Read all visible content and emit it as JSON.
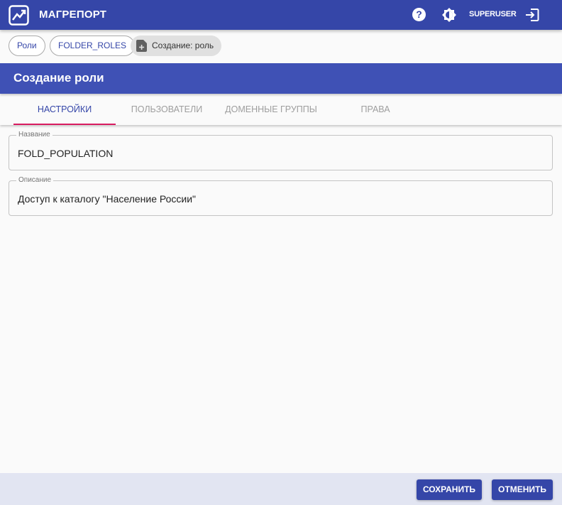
{
  "app": {
    "title": "МАГРЕПОРТ",
    "user": "SUPERUSER",
    "help_symbol": "?"
  },
  "breadcrumbs": [
    {
      "label": "Роли"
    },
    {
      "label": "FOLDER_ROLES"
    },
    {
      "label": "Создание: роль",
      "icon": "new-document-icon"
    }
  ],
  "page": {
    "title": "Создание роли"
  },
  "tabs": [
    {
      "label": "НАСТРОЙКИ",
      "active": true
    },
    {
      "label": "ПОЛЬЗОВАТЕЛИ",
      "active": false
    },
    {
      "label": "ДОМЕННЫЕ ГРУППЫ",
      "active": false
    },
    {
      "label": "ПРАВА",
      "active": false
    }
  ],
  "form": {
    "name": {
      "label": "Название",
      "value": "FOLD_POPULATION"
    },
    "description": {
      "label": "Описание",
      "value": "Доступ к каталогу \"Население России\""
    }
  },
  "footer": {
    "save_label": "СОХРАНИТЬ",
    "cancel_label": "ОТМЕНИТЬ"
  },
  "colors": {
    "appbar": "#3546a8",
    "header": "#3f51b5",
    "tab_indicator": "#d81b60",
    "footer": "#e2e5f2"
  }
}
